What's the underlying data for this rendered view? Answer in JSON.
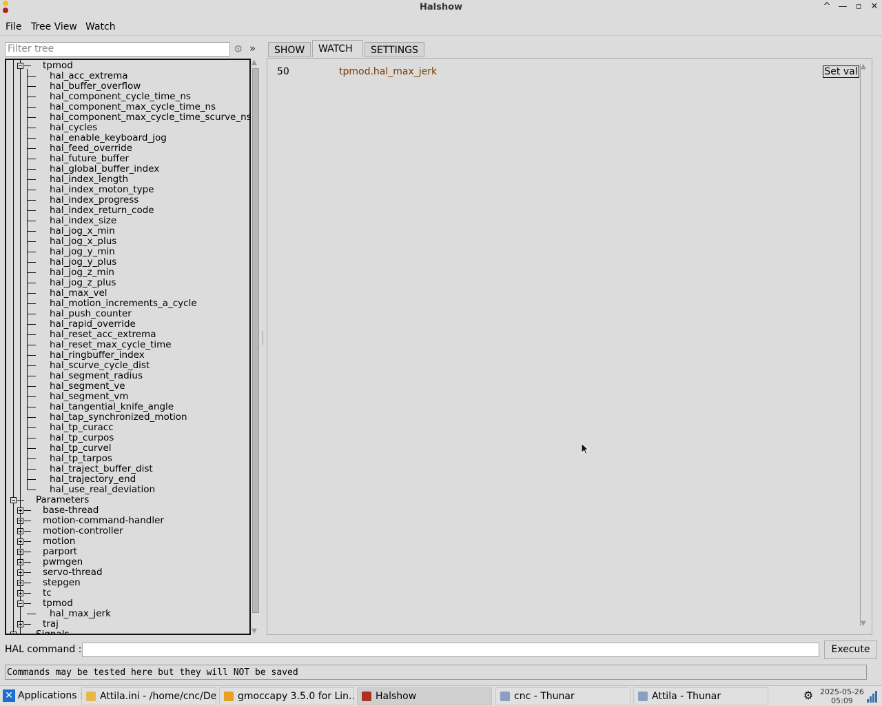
{
  "window": {
    "title": "Halshow",
    "buttons": {
      "maximize": "^",
      "minimize": "—",
      "restore": "▫",
      "close": "✕"
    }
  },
  "menu": {
    "file": "File",
    "tree_view": "Tree View",
    "watch": "Watch"
  },
  "filter": {
    "placeholder": "Filter tree",
    "more": "»"
  },
  "tree": {
    "tpmod_top": "tpmod",
    "pins": [
      "hal_acc_extrema",
      "hal_buffer_overflow",
      "hal_component_cycle_time_ns",
      "hal_component_max_cycle_time_ns",
      "hal_component_max_cycle_time_scurve_ns",
      "hal_cycles",
      "hal_enable_keyboard_jog",
      "hal_feed_override",
      "hal_future_buffer",
      "hal_global_buffer_index",
      "hal_index_length",
      "hal_index_moton_type",
      "hal_index_progress",
      "hal_index_return_code",
      "hal_index_size",
      "hal_jog_x_min",
      "hal_jog_x_plus",
      "hal_jog_y_min",
      "hal_jog_y_plus",
      "hal_jog_z_min",
      "hal_jog_z_plus",
      "hal_max_vel",
      "hal_motion_increments_a_cycle",
      "hal_push_counter",
      "hal_rapid_override",
      "hal_reset_acc_extrema",
      "hal_reset_max_cycle_time",
      "hal_ringbuffer_index",
      "hal_scurve_cycle_dist",
      "hal_segment_radius",
      "hal_segment_ve",
      "hal_segment_vm",
      "hal_tangential_knife_angle",
      "hal_tap_synchronized_motion",
      "hal_tp_curacc",
      "hal_tp_curpos",
      "hal_tp_curvel",
      "hal_tp_tarpos",
      "hal_traject_buffer_dist",
      "hal_trajectory_end",
      "hal_use_real_deviation"
    ],
    "parameters_label": "Parameters",
    "parameters": [
      "base-thread",
      "motion-command-handler",
      "motion-controller",
      "motion",
      "parport",
      "pwmgen",
      "servo-thread",
      "stepgen",
      "tc"
    ],
    "tpmod_param": "tpmod",
    "tpmod_param_child": "hal_max_jerk",
    "traj": "traj",
    "signals": "Signals"
  },
  "tabs": {
    "show": "SHOW",
    "watch": "WATCH",
    "settings": "SETTINGS",
    "active": "WATCH"
  },
  "watch_list": [
    {
      "value": "50",
      "name": "tpmod.hal_max_jerk",
      "button": "Set val"
    }
  ],
  "hal_command": {
    "label": "HAL command :",
    "value": "",
    "execute": "Execute"
  },
  "status": "Commands may be tested here but they will NOT be saved",
  "taskbar": {
    "applications": "Applications :",
    "tasks": [
      {
        "label": "Attila.ini - /home/cnc/De...",
        "icon": "text-editor-icon",
        "color": "#e8b84a"
      },
      {
        "label": "gmoccapy  3.5.0 for Lin...",
        "icon": "gmoccapy-icon",
        "color": "#e8a020"
      },
      {
        "label": "Halshow",
        "icon": "halshow-icon",
        "color": "#b03020"
      },
      {
        "label": "cnc - Thunar",
        "icon": "folder-icon",
        "color": "#8aa0c0"
      },
      {
        "label": "Attila - Thunar",
        "icon": "folder-icon",
        "color": "#8aa0c0"
      }
    ],
    "clock_date": "2025-05-26",
    "clock_time": "05:09"
  }
}
